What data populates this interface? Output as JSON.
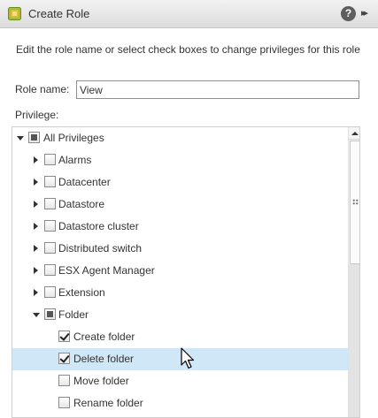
{
  "window": {
    "title": "Create Role",
    "help_label": "?",
    "expand_label": "▸▸"
  },
  "form": {
    "instructions": "Edit the role name or select check boxes to change privileges for this role",
    "role_name_label": "Role name:",
    "role_name_value": "View",
    "privilege_label": "Privilege:"
  },
  "tree": {
    "items": [
      {
        "label": "All Privileges",
        "expander": "expanded",
        "state": "partial",
        "level": 0
      },
      {
        "label": "Alarms",
        "expander": "collapsed",
        "state": "unchecked",
        "level": 1
      },
      {
        "label": "Datacenter",
        "expander": "collapsed",
        "state": "unchecked",
        "level": 1
      },
      {
        "label": "Datastore",
        "expander": "collapsed",
        "state": "unchecked",
        "level": 1
      },
      {
        "label": "Datastore cluster",
        "expander": "collapsed",
        "state": "unchecked",
        "level": 1
      },
      {
        "label": "Distributed switch",
        "expander": "collapsed",
        "state": "unchecked",
        "level": 1
      },
      {
        "label": "ESX Agent Manager",
        "expander": "collapsed",
        "state": "unchecked",
        "level": 1
      },
      {
        "label": "Extension",
        "expander": "collapsed",
        "state": "unchecked",
        "level": 1
      },
      {
        "label": "Folder",
        "expander": "expanded",
        "state": "partial",
        "level": 1
      },
      {
        "label": "Create folder",
        "expander": "none",
        "state": "checked",
        "level": 2
      },
      {
        "label": "Delete folder",
        "expander": "none",
        "state": "checked",
        "level": 2,
        "selected": true
      },
      {
        "label": "Move folder",
        "expander": "none",
        "state": "unchecked",
        "level": 2
      },
      {
        "label": "Rename folder",
        "expander": "none",
        "state": "unchecked",
        "level": 2
      }
    ]
  },
  "colors": {
    "selected_row": "#d0e7f8",
    "help_button": "#5e5e5e"
  }
}
